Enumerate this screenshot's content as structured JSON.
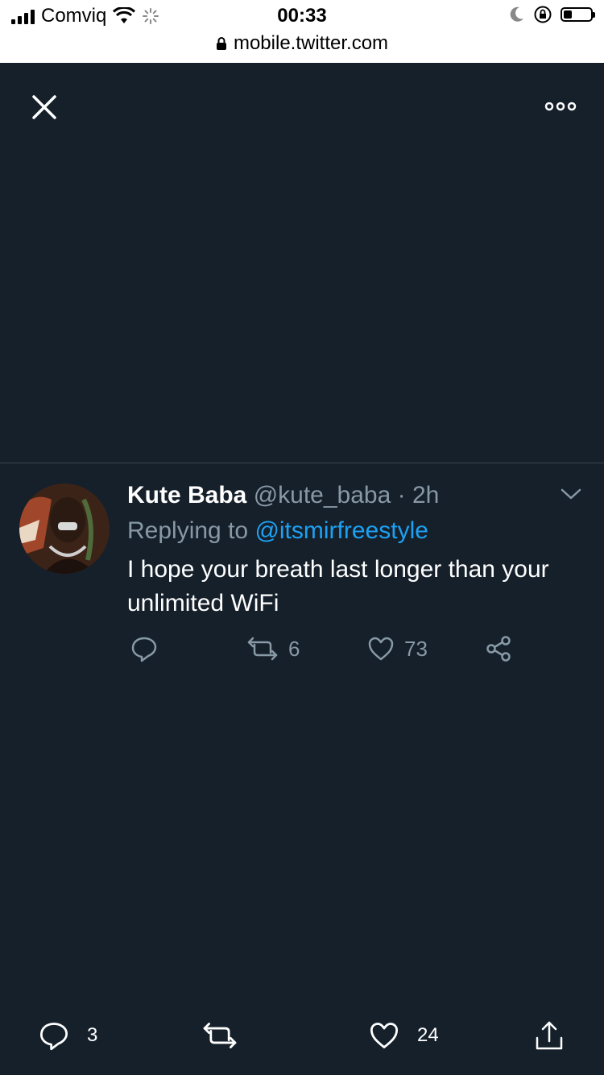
{
  "status_bar": {
    "carrier": "Comviq",
    "time": "00:33",
    "url": "mobile.twitter.com",
    "battery_level": 0.3
  },
  "overlay": {
    "close_icon": "close-icon",
    "more_icon": "more-options-icon"
  },
  "tweet": {
    "display_name": "Kute Baba",
    "handle": "@kute_baba",
    "separator": "·",
    "age": "2h",
    "replying_prefix": "Replying to",
    "replying_to": "@itsmirfreestyle",
    "text": "I hope your breath last longer than your unlimited WiFi",
    "actions": {
      "reply_count": "",
      "retweet_count": "6",
      "like_count": "73"
    }
  },
  "bottom_bar": {
    "reply_count": "3",
    "retweet_count": "",
    "like_count": "24"
  },
  "colors": {
    "background": "#15202b",
    "muted": "#8899a6",
    "accent": "#1da1f2",
    "divider": "#38444d"
  }
}
